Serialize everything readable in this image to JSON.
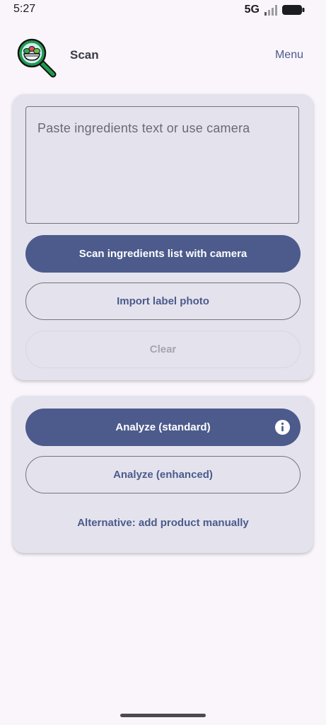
{
  "status_bar": {
    "time": "5:27",
    "network": "5G",
    "icons": [
      "signal-icon",
      "battery-icon"
    ]
  },
  "app_bar": {
    "title": "Scan",
    "menu_label": "Menu",
    "logo_icon": "magnifier-salad-bowl-icon"
  },
  "input_card": {
    "ingredients_value": "",
    "ingredients_placeholder": "Paste ingredients text or use camera",
    "scan_camera_label": "Scan ingredients list with camera",
    "import_photo_label": "Import label photo",
    "clear_label": "Clear"
  },
  "analyze_card": {
    "analyze_standard_label": "Analyze (standard)",
    "info_icon": "info-icon",
    "analyze_enhanced_label": "Analyze (enhanced)",
    "alternative_label": "Alternative: add product manually"
  },
  "colors": {
    "primary": "#4c5b8c",
    "card_background": "#e4e3ed",
    "page_background": "#f9f5fb",
    "disabled_text": "#a6a5ad"
  }
}
